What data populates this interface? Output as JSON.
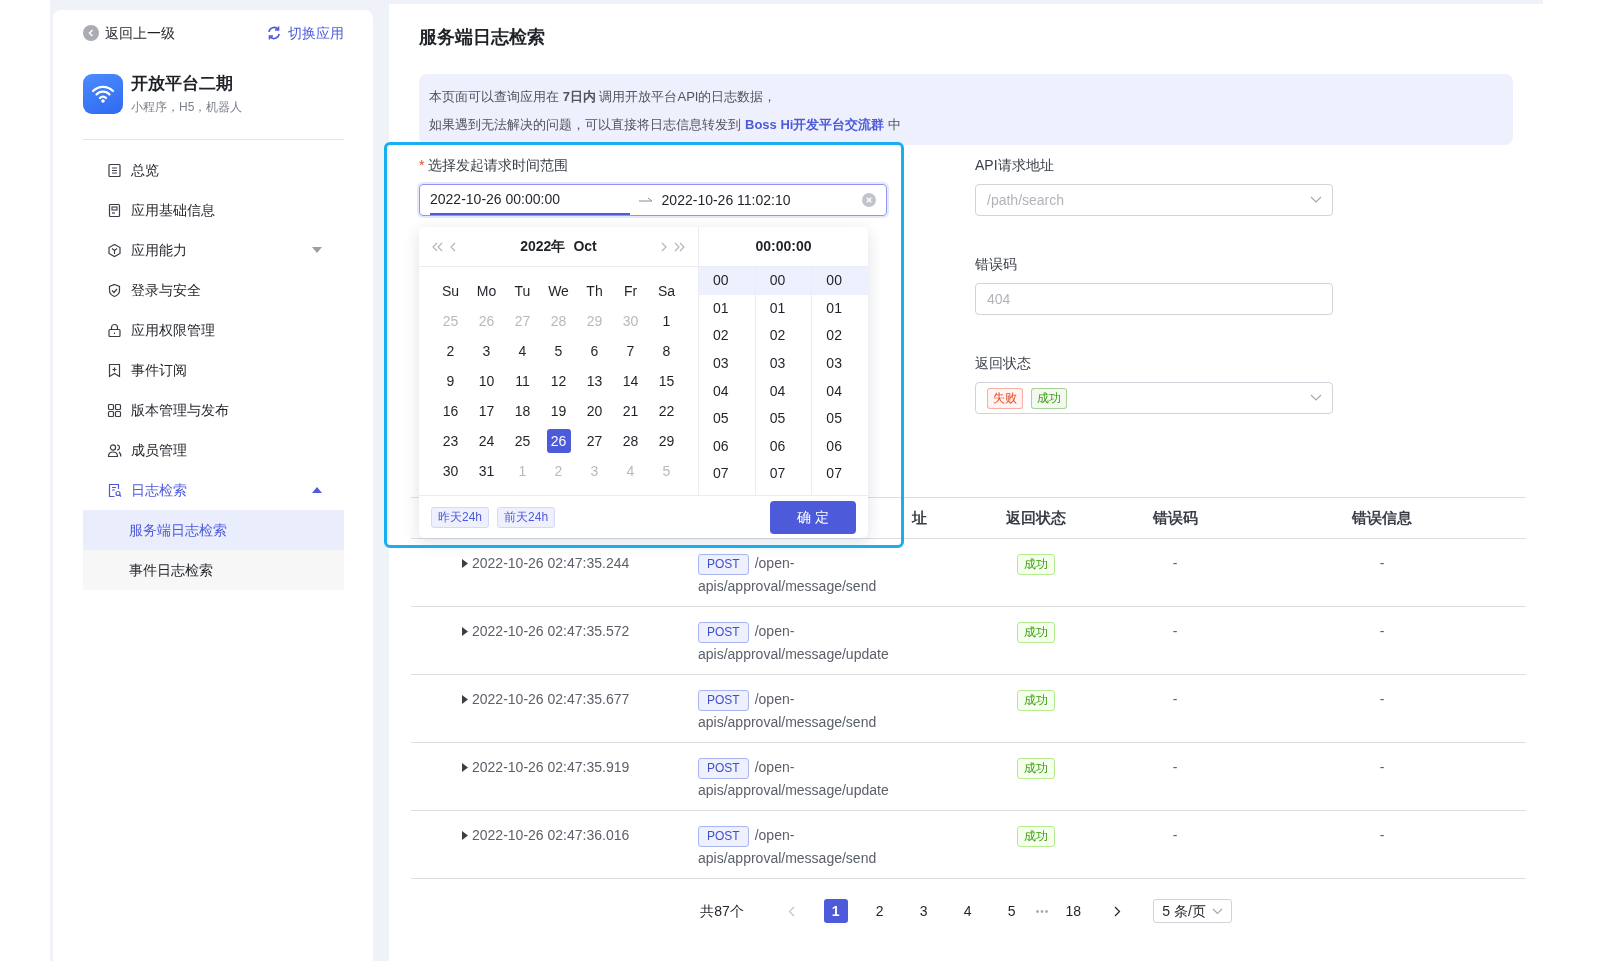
{
  "sidebar": {
    "back": "返回上一级",
    "switch_app": "切换应用",
    "app": {
      "name": "开放平台二期",
      "subtitle": "小程序，H5，机器人"
    },
    "menu": [
      {
        "label": "总览",
        "selected": false
      },
      {
        "label": "应用基础信息",
        "selected": false
      },
      {
        "label": "应用能力",
        "selected": false,
        "expanded": false
      },
      {
        "label": "登录与安全",
        "selected": false
      },
      {
        "label": "应用权限管理",
        "selected": false
      },
      {
        "label": "事件订阅",
        "selected": false
      },
      {
        "label": "版本管理与发布",
        "selected": false
      },
      {
        "label": "成员管理",
        "selected": false
      },
      {
        "label": "日志检索",
        "selected": true,
        "expanded": true,
        "children": [
          {
            "label": "服务端日志检索",
            "selected": true
          },
          {
            "label": "事件日志检索",
            "selected": false
          }
        ]
      }
    ]
  },
  "main": {
    "title": "服务端日志检索",
    "notice": {
      "line_1": "本页面可以查询应用在 **7日内** 调用开放平台API的日志数据，",
      "line_2_text": "如果遇到无法解决的问题，可以直接将日志信息转发到",
      "line_2_link": "Boss Hi开发平台交流群",
      "line_2_end": "中"
    },
    "form": {
      "time_range": {
        "label": "选择发起请求时间范围",
        "required_mark": "*",
        "start": "2022-10-26 00:00:00",
        "end": "2022-10-26 11:02:10",
        "start_active": true
      },
      "api_path": {
        "label": "API请求地址",
        "placeholder": "/path/search"
      },
      "error_code": {
        "label": "错误码",
        "placeholder": "404"
      },
      "status": {
        "label": "返回状态",
        "tags": [
          {
            "label": "失败",
            "color": "#e8482c"
          },
          {
            "label": "成功",
            "color": "#389e0d"
          }
        ]
      }
    },
    "picker": {
      "year": "2022年",
      "month": "Oct",
      "weekdays": [
        "Su",
        "Mo",
        "Tu",
        "We",
        "Th",
        "Fr",
        "Sa"
      ],
      "days": [
        {
          "day": "25",
          "in_month": false,
          "selected": false
        },
        {
          "day": "26",
          "in_month": false,
          "selected": false
        },
        {
          "day": "27",
          "in_month": false,
          "selected": false
        },
        {
          "day": "28",
          "in_month": false,
          "selected": false
        },
        {
          "day": "29",
          "in_month": false,
          "selected": false
        },
        {
          "day": "30",
          "in_month": false,
          "selected": false
        },
        {
          "day": "1",
          "in_month": true,
          "selected": false
        },
        {
          "day": "2",
          "in_month": true,
          "selected": false
        },
        {
          "day": "3",
          "in_month": true,
          "selected": false
        },
        {
          "day": "4",
          "in_month": true,
          "selected": false
        },
        {
          "day": "5",
          "in_month": true,
          "selected": false
        },
        {
          "day": "6",
          "in_month": true,
          "selected": false
        },
        {
          "day": "7",
          "in_month": true,
          "selected": false
        },
        {
          "day": "8",
          "in_month": true,
          "selected": false
        },
        {
          "day": "9",
          "in_month": true,
          "selected": false
        },
        {
          "day": "10",
          "in_month": true,
          "selected": false
        },
        {
          "day": "11",
          "in_month": true,
          "selected": false
        },
        {
          "day": "12",
          "in_month": true,
          "selected": false
        },
        {
          "day": "13",
          "in_month": true,
          "selected": false
        },
        {
          "day": "14",
          "in_month": true,
          "selected": false
        },
        {
          "day": "15",
          "in_month": true,
          "selected": false
        },
        {
          "day": "16",
          "in_month": true,
          "selected": false
        },
        {
          "day": "17",
          "in_month": true,
          "selected": false
        },
        {
          "day": "18",
          "in_month": true,
          "selected": false
        },
        {
          "day": "19",
          "in_month": true,
          "selected": false
        },
        {
          "day": "20",
          "in_month": true,
          "selected": false
        },
        {
          "day": "21",
          "in_month": true,
          "selected": false
        },
        {
          "day": "22",
          "in_month": true,
          "selected": false
        },
        {
          "day": "23",
          "in_month": true,
          "selected": false
        },
        {
          "day": "24",
          "in_month": true,
          "selected": false
        },
        {
          "day": "25",
          "in_month": true,
          "selected": false
        },
        {
          "day": "26",
          "in_month": true,
          "selected": true
        },
        {
          "day": "27",
          "in_month": true,
          "selected": false
        },
        {
          "day": "28",
          "in_month": true,
          "selected": false
        },
        {
          "day": "29",
          "in_month": true,
          "selected": false
        },
        {
          "day": "30",
          "in_month": true,
          "selected": false
        },
        {
          "day": "31",
          "in_month": true,
          "selected": false
        },
        {
          "day": "1",
          "in_month": false,
          "selected": false
        },
        {
          "day": "2",
          "in_month": false,
          "selected": false
        },
        {
          "day": "3",
          "in_month": false,
          "selected": false
        },
        {
          "day": "4",
          "in_month": false,
          "selected": false
        },
        {
          "day": "5",
          "in_month": false,
          "selected": false
        }
      ],
      "time": {
        "display": "00:00:00",
        "columns": [
          [
            {
              "value": "00",
              "selected": true
            },
            {
              "value": "01",
              "selected": false
            },
            {
              "value": "02",
              "selected": false
            },
            {
              "value": "03",
              "selected": false
            },
            {
              "value": "04",
              "selected": false
            },
            {
              "value": "05",
              "selected": false
            },
            {
              "value": "06",
              "selected": false
            },
            {
              "value": "07",
              "selected": false
            }
          ],
          [
            {
              "value": "00",
              "selected": true
            },
            {
              "value": "01",
              "selected": false
            },
            {
              "value": "02",
              "selected": false
            },
            {
              "value": "03",
              "selected": false
            },
            {
              "value": "04",
              "selected": false
            },
            {
              "value": "05",
              "selected": false
            },
            {
              "value": "06",
              "selected": false
            },
            {
              "value": "07",
              "selected": false
            }
          ],
          [
            {
              "value": "00",
              "selected": true
            },
            {
              "value": "01",
              "selected": false
            },
            {
              "value": "02",
              "selected": false
            },
            {
              "value": "03",
              "selected": false
            },
            {
              "value": "04",
              "selected": false
            },
            {
              "value": "05",
              "selected": false
            },
            {
              "value": "06",
              "selected": false
            },
            {
              "value": "07",
              "selected": false
            }
          ]
        ]
      },
      "shortcuts": [
        "昨天24h",
        "前天24h"
      ],
      "ok": "确 定"
    },
    "table": {
      "column_2": "址",
      "columns": [
        "返回状态",
        "错误码",
        "错误信息"
      ],
      "rows": [
        {
          "time": "2022-10-26 02:47:35.244",
          "method": "POST",
          "path": "/open-apis/approval/message/send",
          "status": "成功",
          "error_code": "-",
          "error_message": "-"
        },
        {
          "time": "2022-10-26 02:47:35.572",
          "method": "POST",
          "path": "/open-apis/approval/message/update",
          "status": "成功",
          "error_code": "-",
          "error_message": "-"
        },
        {
          "time": "2022-10-26 02:47:35.677",
          "method": "POST",
          "path": "/open-apis/approval/message/send",
          "status": "成功",
          "error_code": "-",
          "error_message": "-"
        },
        {
          "time": "2022-10-26 02:47:35.919",
          "method": "POST",
          "path": "/open-apis/approval/message/update",
          "status": "成功",
          "error_code": "-",
          "error_message": "-"
        },
        {
          "time": "2022-10-26 02:47:36.016",
          "method": "POST",
          "path": "/open-apis/approval/message/send",
          "status": "成功",
          "error_code": "-",
          "error_message": "-"
        }
      ]
    },
    "pagination": {
      "total": "共87个",
      "prev_disabled": true,
      "next_disabled": false,
      "pages": [
        {
          "kind": "page",
          "label": "1",
          "selected": true
        },
        {
          "kind": "page",
          "label": "2",
          "selected": false
        },
        {
          "kind": "page",
          "label": "3",
          "selected": false
        },
        {
          "kind": "page",
          "label": "4",
          "selected": false
        },
        {
          "kind": "page",
          "label": "5",
          "selected": false
        },
        {
          "kind": "ellipsis",
          "label": "•••"
        },
        {
          "kind": "page",
          "label": "18",
          "selected": false
        }
      ],
      "page_size": "5 条/页"
    }
  }
}
